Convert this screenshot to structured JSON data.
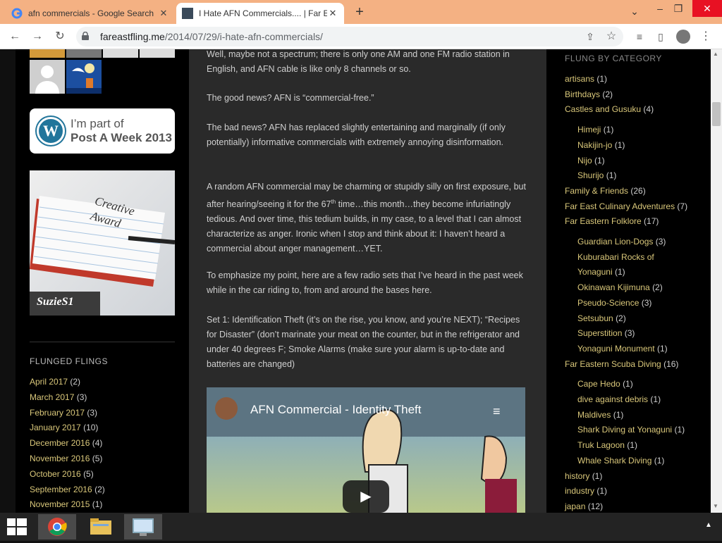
{
  "browser": {
    "tabs": [
      {
        "title": "afn commercials - Google Search",
        "active": false
      },
      {
        "title": "I Hate AFN Commercials.... | Far E",
        "active": true
      }
    ],
    "url_host": "fareastfling.me",
    "url_path": "/2014/07/29/i-hate-afn-commercials/"
  },
  "left_sidebar": {
    "badge_line1": "I’m part of",
    "badge_line2": "Post A Week 2013",
    "award_text": "Creative Award",
    "award_signature": "SuzieS1",
    "archive_heading": "FLUNGED FLINGS",
    "archive": [
      {
        "label": "April 2017",
        "count": "(2)"
      },
      {
        "label": "March 2017",
        "count": "(3)"
      },
      {
        "label": "February 2017",
        "count": "(3)"
      },
      {
        "label": "January 2017",
        "count": "(10)"
      },
      {
        "label": "December 2016",
        "count": "(4)"
      },
      {
        "label": "November 2016",
        "count": "(5)"
      },
      {
        "label": "October 2016",
        "count": "(5)"
      },
      {
        "label": "September 2016",
        "count": "(2)"
      },
      {
        "label": "November 2015",
        "count": "(1)"
      }
    ]
  },
  "content": {
    "p1": "Well, maybe not a spectrum; there is only one AM and one FM radio station in English, and AFN cable is like only 8 channels or so.",
    "p2": "The good news?  AFN is “commercial-free.”",
    "p3": "The bad news?  AFN has replaced slightly entertaining and marginally (if only potentially) informative commercials with extremely annoying disinformation.",
    "p4a": "A random AFN commercial may be charming or stupidly silly on first exposure, but after hearing/seeing it for the 67",
    "p4sup": "th",
    "p4b": " time…this month…they become infuriatingly tedious.  And over time, this tedium builds, in my case, to a level that I can almost characterize as anger.  Ironic when I stop and think about it:  I haven’t heard a commercial about anger management…YET.",
    "p5": "To emphasize my point, here are a few radio sets that I’ve heard in the past week while in the car riding to, from and around the bases here.",
    "p6": "Set 1:     Identification Theft (it’s on the rise, you know, and you’re NEXT); “Recipes for Disaster” (don’t marinate your meat on the counter, but in the refrigerator and under 40 degrees F; Smoke Alarms (make sure your alarm is up-to-date and batteries are changed)",
    "video_title": "AFN Commercial - Identity Theft"
  },
  "right_sidebar": {
    "heading": "FLUNG BY CATEGORY",
    "categories": [
      {
        "label": "artisans",
        "count": "(1)",
        "level": 0
      },
      {
        "label": "Birthdays",
        "count": "(2)",
        "level": 0
      },
      {
        "label": "Castles and Gusuku",
        "count": "(4)",
        "level": 0
      },
      {
        "label": "Himeji",
        "count": "(1)",
        "level": 1,
        "gap": true
      },
      {
        "label": "Nakijin-jo",
        "count": "(1)",
        "level": 1
      },
      {
        "label": "Nijo",
        "count": "(1)",
        "level": 1
      },
      {
        "label": "Shurijo",
        "count": "(1)",
        "level": 1
      },
      {
        "label": "Family & Friends",
        "count": "(26)",
        "level": 0
      },
      {
        "label": "Far East Culinary Adventures",
        "count": "(7)",
        "level": 0
      },
      {
        "label": "Far Eastern Folklore",
        "count": "(17)",
        "level": 0
      },
      {
        "label": "Guardian Lion-Dogs",
        "count": "(3)",
        "level": 1,
        "gap": true
      },
      {
        "label": "Kuburabari Rocks of",
        "count": "",
        "level": 1
      },
      {
        "label": "Yonaguni",
        "count": "(1)",
        "level": 1
      },
      {
        "label": "Okinawan Kijimuna",
        "count": "(2)",
        "level": 1
      },
      {
        "label": "Pseudo-Science",
        "count": "(3)",
        "level": 1
      },
      {
        "label": "Setsubun",
        "count": "(2)",
        "level": 1
      },
      {
        "label": "Superstition",
        "count": "(3)",
        "level": 1
      },
      {
        "label": "Yonaguni Monument",
        "count": "(1)",
        "level": 1
      },
      {
        "label": "Far Eastern Scuba Diving",
        "count": "(16)",
        "level": 0
      },
      {
        "label": "Cape Hedo",
        "count": "(1)",
        "level": 1,
        "gap": true
      },
      {
        "label": "dive against debris",
        "count": "(1)",
        "level": 1
      },
      {
        "label": "Maldives",
        "count": "(1)",
        "level": 1
      },
      {
        "label": "Shark Diving at Yonaguni",
        "count": "(1)",
        "level": 1
      },
      {
        "label": "Truk Lagoon",
        "count": "(1)",
        "level": 1
      },
      {
        "label": "Whale Shark Diving",
        "count": "(1)",
        "level": 1
      },
      {
        "label": "history",
        "count": "(1)",
        "level": 0
      },
      {
        "label": "industry",
        "count": "(1)",
        "level": 0
      },
      {
        "label": "japan",
        "count": "(12)",
        "level": 0
      }
    ]
  },
  "colors": {
    "link": "#d9c77a",
    "accent_tabbar": "#f4b183"
  }
}
